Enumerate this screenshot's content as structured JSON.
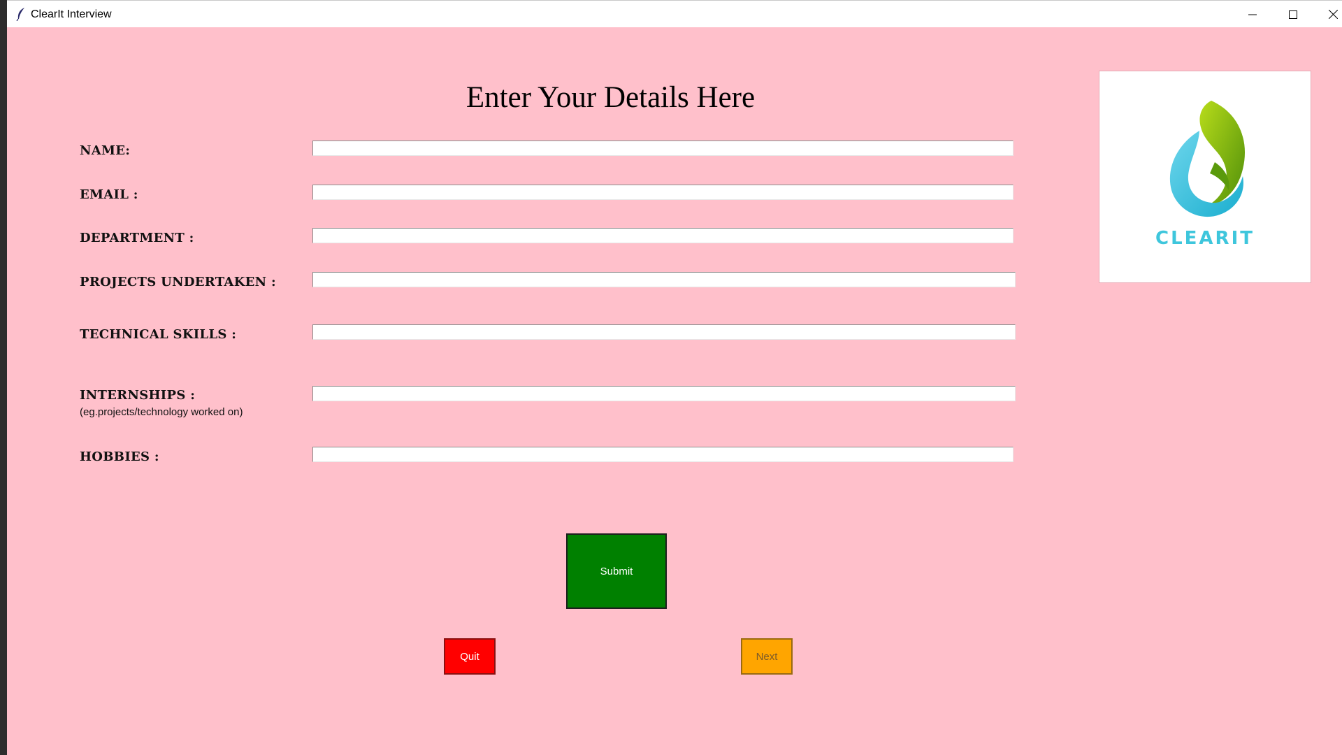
{
  "window": {
    "title": "ClearIt Interview",
    "controls": [
      "minimize",
      "maximize",
      "close"
    ]
  },
  "form": {
    "heading": "Enter Your Details Here",
    "fields": [
      {
        "label": "NAME:",
        "value": ""
      },
      {
        "label": "EMAIL :",
        "value": ""
      },
      {
        "label": "DEPARTMENT :",
        "value": ""
      },
      {
        "label": "PROJECTS UNDERTAKEN :",
        "value": ""
      },
      {
        "label": "TECHNICAL SKILLS :",
        "value": ""
      },
      {
        "label": "INTERNSHIPS :",
        "sublabel": "(eg.projects/technology worked on)",
        "value": ""
      },
      {
        "label": "HOBBIES :",
        "value": ""
      }
    ]
  },
  "logo": {
    "text": "CLEARIT",
    "colors": {
      "leaf_green": "#7dbb12",
      "drop_cyan": "#3ec6dc"
    }
  },
  "buttons": {
    "submit": "Submit",
    "quit": "Quit",
    "next": "Next"
  },
  "colors": {
    "background": "#ffc0cb",
    "submit": "#008000",
    "quit": "#ff0000",
    "next": "#ffa500"
  }
}
